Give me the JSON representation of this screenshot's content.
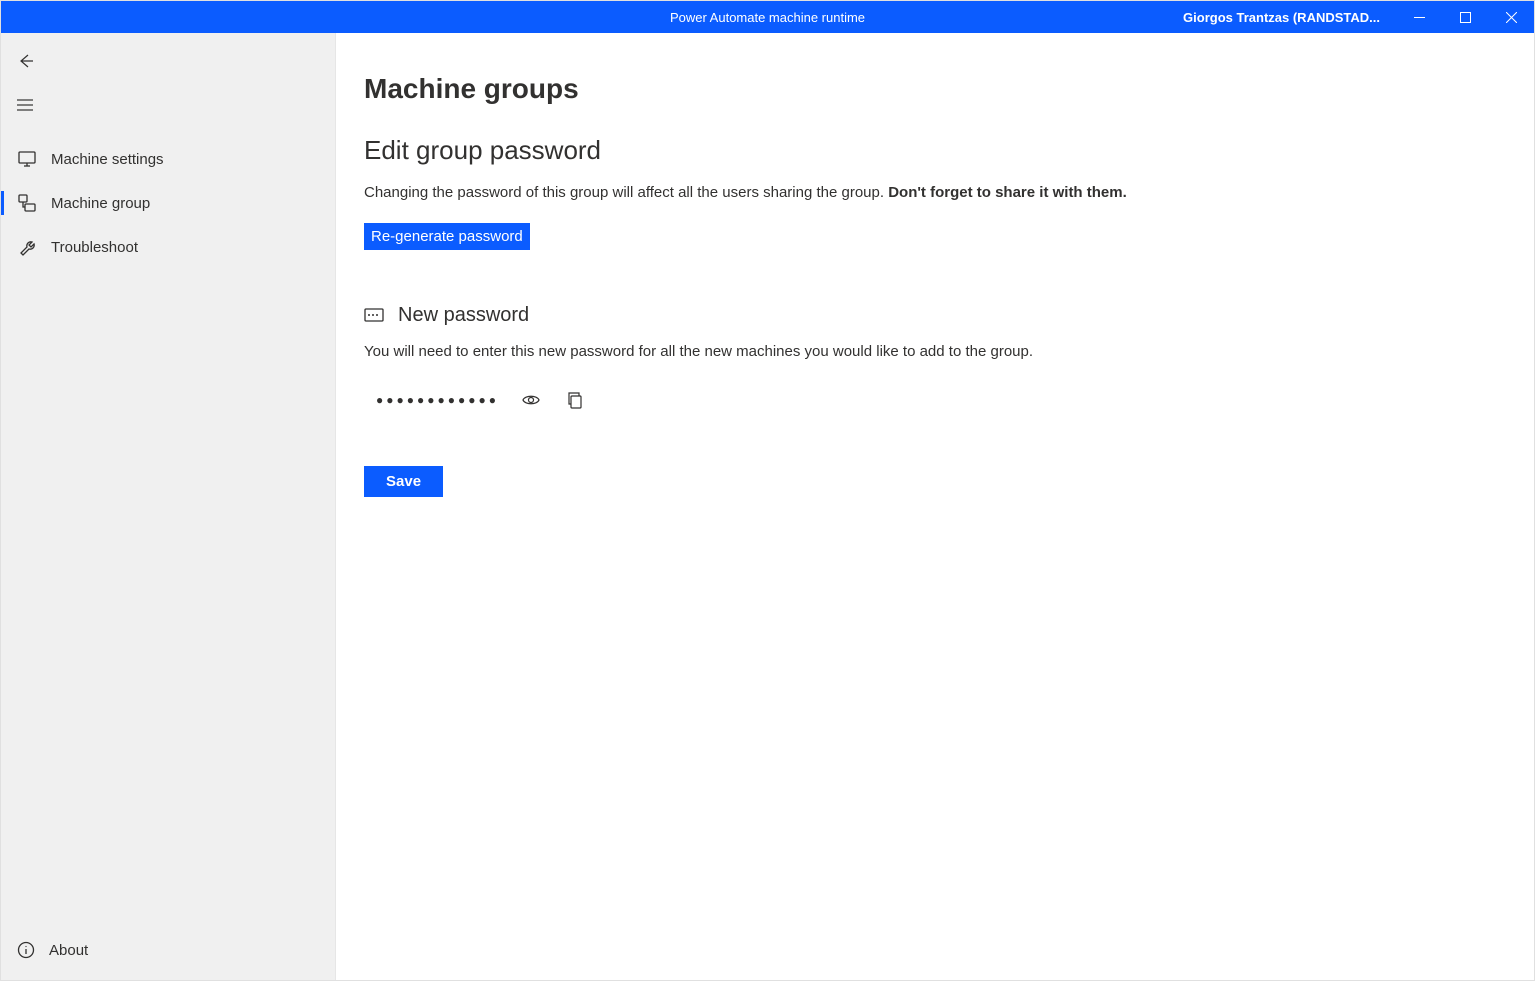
{
  "titlebar": {
    "title": "Power Automate machine runtime",
    "user": "Giorgos Trantzas (RANDSTAD..."
  },
  "sidebar": {
    "items": [
      {
        "label": "Machine settings"
      },
      {
        "label": "Machine group"
      },
      {
        "label": "Troubleshoot"
      }
    ],
    "footer": {
      "about": "About"
    }
  },
  "main": {
    "page_title": "Machine groups",
    "section_title": "Edit group password",
    "section_desc_plain": "Changing the password of this group will affect all the users sharing the group. ",
    "section_desc_bold": "Don't forget to share it with them.",
    "regenerate_label": "Re-generate password",
    "new_password_title": "New password",
    "new_password_desc": "You will need to enter this new password for all the new machines you would like to add to the group.",
    "password_mask": "●●●●●●●●●●●●",
    "save_label": "Save"
  }
}
